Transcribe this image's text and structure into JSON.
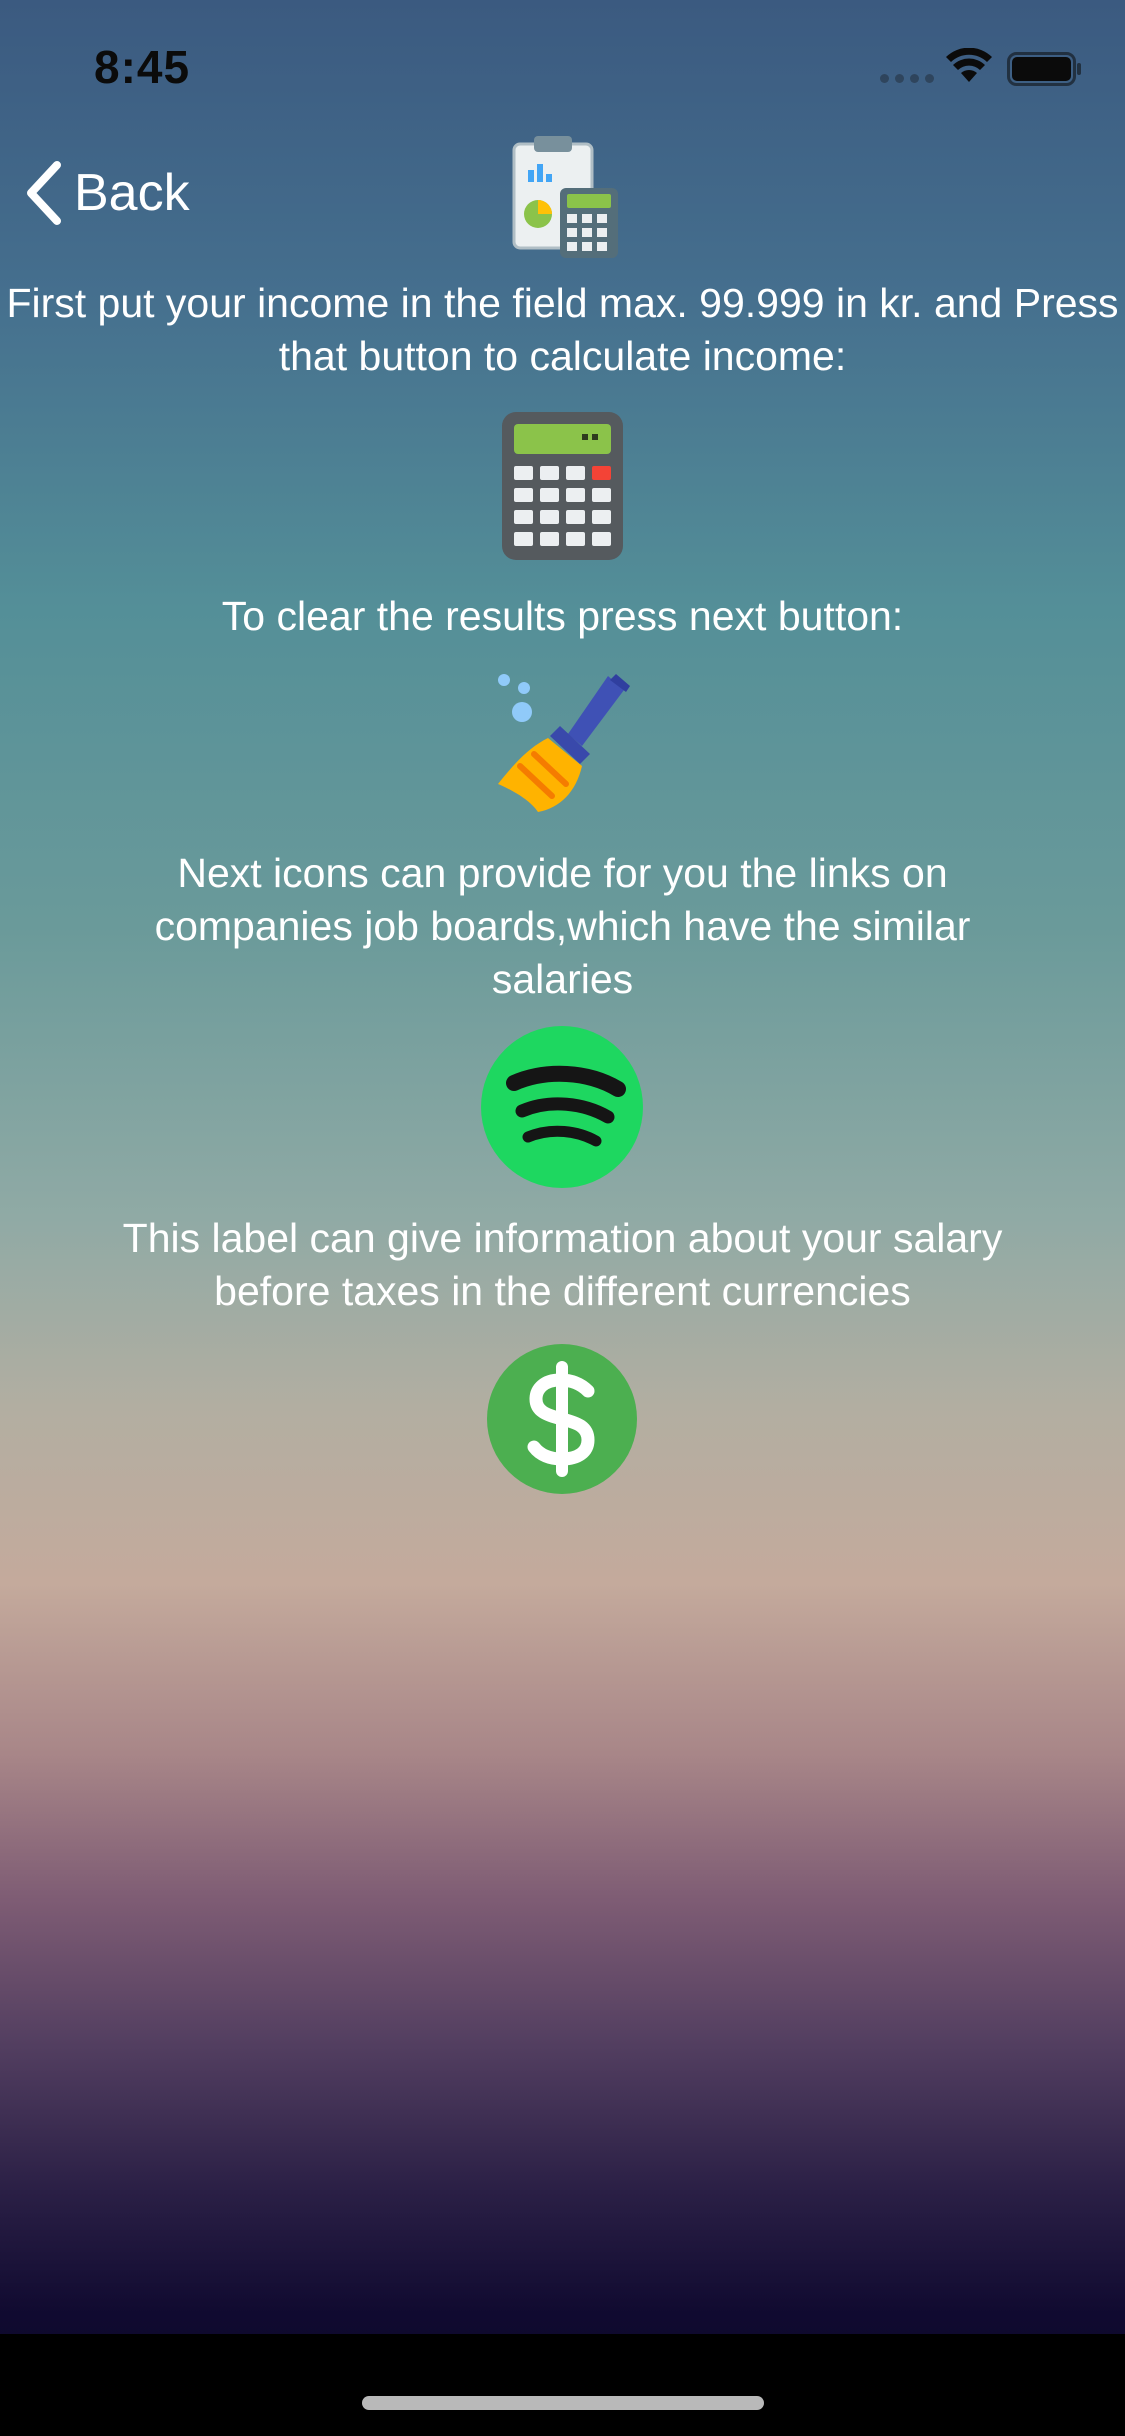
{
  "status_bar": {
    "time": "8:45"
  },
  "nav": {
    "back_label": "Back"
  },
  "instructions": {
    "income_text": "First put your income in the field max.  99.999 in kr. and Press that button to calculate income:",
    "clear_text": "To clear the results press next button:",
    "links_text": "Next icons can provide for you the links on companies job boards,which have the similar salaries",
    "currency_text": "This label can give information about your salary before taxes in the different currencies"
  },
  "icons": {
    "header": "calculator-chart-icon",
    "calculate": "calculator-icon",
    "clear": "broom-icon",
    "links": "spotify-icon",
    "currency": "dollar-icon"
  },
  "colors": {
    "spotify_green": "#1ED760",
    "dollar_green": "#4CAF50",
    "calc_screen": "#8BC34A"
  }
}
